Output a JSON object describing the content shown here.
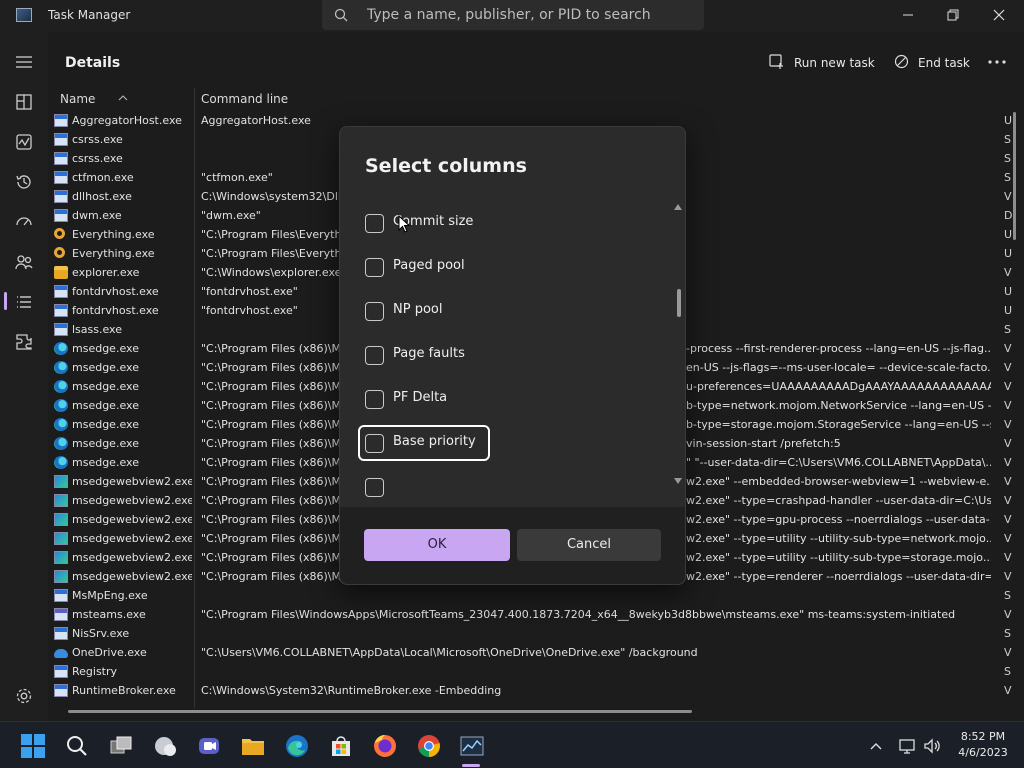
{
  "window": {
    "title": "Task Manager",
    "search_placeholder": "Type a name, publisher, or PID to search"
  },
  "header": {
    "page_title": "Details",
    "run_new_task": "Run new task",
    "end_task": "End task"
  },
  "table": {
    "columns": [
      "Name",
      "Command line"
    ],
    "rows": [
      {
        "icon": "exe-icon",
        "name": "AggregatorHost.exe",
        "cmd": "AggregatorHost.exe"
      },
      {
        "icon": "exe-icon",
        "name": "csrss.exe",
        "cmd": ""
      },
      {
        "icon": "exe-icon",
        "name": "csrss.exe",
        "cmd": ""
      },
      {
        "icon": "exe-icon",
        "name": "ctfmon.exe",
        "cmd": "\"ctfmon.exe\""
      },
      {
        "icon": "exe-icon",
        "name": "dllhost.exe",
        "cmd": "C:\\Windows\\system32\\Dll"
      },
      {
        "icon": "exe-icon",
        "name": "dwm.exe",
        "cmd": "\"dwm.exe\""
      },
      {
        "icon": "everything-icon",
        "name": "Everything.exe",
        "cmd": "\"C:\\Program Files\\Everythi"
      },
      {
        "icon": "everything-icon",
        "name": "Everything.exe",
        "cmd": "\"C:\\Program Files\\Everythi"
      },
      {
        "icon": "folder-icon",
        "name": "explorer.exe",
        "cmd": "\"C:\\Windows\\explorer.exe"
      },
      {
        "icon": "exe-icon",
        "name": "fontdrvhost.exe",
        "cmd": "\"fontdrvhost.exe\""
      },
      {
        "icon": "exe-icon",
        "name": "fontdrvhost.exe",
        "cmd": "\"fontdrvhost.exe\""
      },
      {
        "icon": "exe-icon",
        "name": "lsass.exe",
        "cmd": ""
      },
      {
        "icon": "edge-icon",
        "name": "msedge.exe",
        "cmd": "\"C:\\Program Files (x86)\\M",
        "cmd2": "-process --first-renderer-process --lang=en-US --js-flag..."
      },
      {
        "icon": "edge-icon",
        "name": "msedge.exe",
        "cmd": "\"C:\\Program Files (x86)\\M",
        "cmd2": "en-US --js-flags=--ms-user-locale= --device-scale-facto..."
      },
      {
        "icon": "edge-icon",
        "name": "msedge.exe",
        "cmd": "\"C:\\Program Files (x86)\\M",
        "cmd2": "u-preferences=UAAAAAAAAADgAAAYAAAAAAAAAAAAA..."
      },
      {
        "icon": "edge-icon",
        "name": "msedge.exe",
        "cmd": "\"C:\\Program Files (x86)\\M",
        "cmd2": "b-type=network.mojom.NetworkService --lang=en-US --..."
      },
      {
        "icon": "edge-icon",
        "name": "msedge.exe",
        "cmd": "\"C:\\Program Files (x86)\\M",
        "cmd2": "b-type=storage.mojom.StorageService --lang=en-US --s..."
      },
      {
        "icon": "edge-icon",
        "name": "msedge.exe",
        "cmd": "\"C:\\Program Files (x86)\\M",
        "cmd2": "vin-session-start /prefetch:5"
      },
      {
        "icon": "edge-icon",
        "name": "msedge.exe",
        "cmd": "\"C:\\Program Files (x86)\\M",
        "cmd2": "\" \"--user-data-dir=C:\\Users\\VM6.COLLABNET\\AppData\\..."
      },
      {
        "icon": "edgewv-icon",
        "name": "msedgewebview2.exe",
        "cmd": "\"C:\\Program Files (x86)\\M",
        "cmd2": "w2.exe\" --embedded-browser-webview=1 --webview-e..."
      },
      {
        "icon": "edgewv-icon",
        "name": "msedgewebview2.exe",
        "cmd": "\"C:\\Program Files (x86)\\M",
        "cmd2": "w2.exe\" --type=crashpad-handler --user-data-dir=C:\\Us..."
      },
      {
        "icon": "edgewv-icon",
        "name": "msedgewebview2.exe",
        "cmd": "\"C:\\Program Files (x86)\\M",
        "cmd2": "w2.exe\" --type=gpu-process --noerrdialogs --user-data-..."
      },
      {
        "icon": "edgewv-icon",
        "name": "msedgewebview2.exe",
        "cmd": "\"C:\\Program Files (x86)\\M",
        "cmd2": "w2.exe\" --type=utility --utility-sub-type=network.mojo..."
      },
      {
        "icon": "edgewv-icon",
        "name": "msedgewebview2.exe",
        "cmd": "\"C:\\Program Files (x86)\\M",
        "cmd2": "w2.exe\" --type=utility --utility-sub-type=storage.mojo..."
      },
      {
        "icon": "edgewv-icon",
        "name": "msedgewebview2.exe",
        "cmd": "\"C:\\Program Files (x86)\\M",
        "cmd2": "w2.exe\" --type=renderer --noerrdialogs --user-data-dir=..."
      },
      {
        "icon": "exe-icon",
        "name": "MsMpEng.exe",
        "cmd": ""
      },
      {
        "icon": "teams-icon",
        "name": "msteams.exe",
        "cmd": "\"C:\\Program Files\\WindowsApps\\MicrosoftTeams_23047.400.1873.7204_x64__8wekyb3d8bbwe\\msteams.exe\" ms-teams:system-initiated"
      },
      {
        "icon": "exe-icon",
        "name": "NisSrv.exe",
        "cmd": ""
      },
      {
        "icon": "onedrive-icon",
        "name": "OneDrive.exe",
        "cmd": "\"C:\\Users\\VM6.COLLABNET\\AppData\\Local\\Microsoft\\OneDrive\\OneDrive.exe\" /background"
      },
      {
        "icon": "exe-icon",
        "name": "Registry",
        "cmd": ""
      },
      {
        "icon": "exe-icon",
        "name": "RuntimeBroker.exe",
        "cmd": "C:\\Windows\\System32\\RuntimeBroker.exe -Embedding"
      }
    ],
    "right_edge_chars": [
      "U",
      "S",
      "S",
      "S",
      "V",
      "D",
      "U",
      "U",
      "V",
      "U",
      "U",
      "S",
      "V",
      "V",
      "V",
      "V",
      "V",
      "V",
      "V",
      "V",
      "V",
      "V",
      "V",
      "V",
      "V",
      "S",
      "V",
      "S",
      "V",
      "S",
      "V"
    ]
  },
  "dialog": {
    "title": "Select columns",
    "options": [
      {
        "label": "Commit size",
        "checked": false
      },
      {
        "label": "Paged pool",
        "checked": false
      },
      {
        "label": "NP pool",
        "checked": false
      },
      {
        "label": "Page faults",
        "checked": false
      },
      {
        "label": "PF Delta",
        "checked": false
      },
      {
        "label": "Base priority",
        "checked": false,
        "focused": true
      }
    ],
    "ok_label": "OK",
    "cancel_label": "Cancel"
  },
  "taskbar": {
    "time": "8:52 PM",
    "date": "4/6/2023"
  },
  "colors": {
    "accent": "#c8a6f2",
    "background": "#1c1c1c",
    "dialog": "#2b2b2b"
  }
}
